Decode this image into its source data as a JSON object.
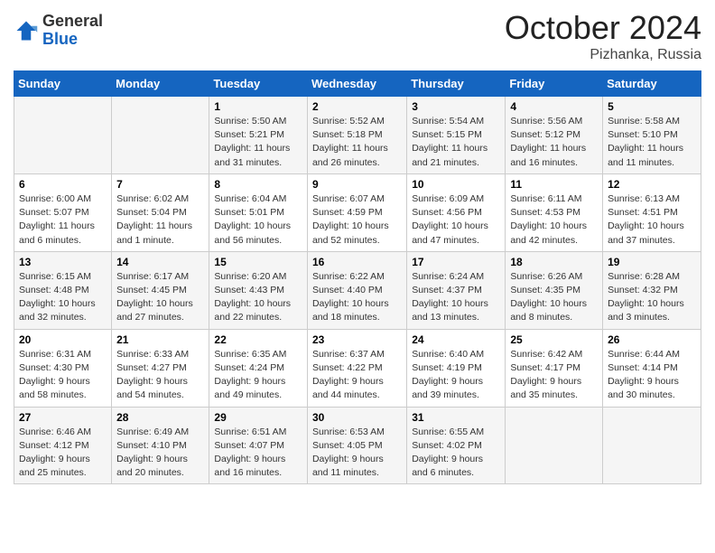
{
  "header": {
    "logo_general": "General",
    "logo_blue": "Blue",
    "month": "October 2024",
    "location": "Pizhanka, Russia"
  },
  "days_of_week": [
    "Sunday",
    "Monday",
    "Tuesday",
    "Wednesday",
    "Thursday",
    "Friday",
    "Saturday"
  ],
  "weeks": [
    [
      {
        "num": "",
        "info": ""
      },
      {
        "num": "",
        "info": ""
      },
      {
        "num": "1",
        "info": "Sunrise: 5:50 AM\nSunset: 5:21 PM\nDaylight: 11 hours\nand 31 minutes."
      },
      {
        "num": "2",
        "info": "Sunrise: 5:52 AM\nSunset: 5:18 PM\nDaylight: 11 hours\nand 26 minutes."
      },
      {
        "num": "3",
        "info": "Sunrise: 5:54 AM\nSunset: 5:15 PM\nDaylight: 11 hours\nand 21 minutes."
      },
      {
        "num": "4",
        "info": "Sunrise: 5:56 AM\nSunset: 5:12 PM\nDaylight: 11 hours\nand 16 minutes."
      },
      {
        "num": "5",
        "info": "Sunrise: 5:58 AM\nSunset: 5:10 PM\nDaylight: 11 hours\nand 11 minutes."
      }
    ],
    [
      {
        "num": "6",
        "info": "Sunrise: 6:00 AM\nSunset: 5:07 PM\nDaylight: 11 hours\nand 6 minutes."
      },
      {
        "num": "7",
        "info": "Sunrise: 6:02 AM\nSunset: 5:04 PM\nDaylight: 11 hours\nand 1 minute."
      },
      {
        "num": "8",
        "info": "Sunrise: 6:04 AM\nSunset: 5:01 PM\nDaylight: 10 hours\nand 56 minutes."
      },
      {
        "num": "9",
        "info": "Sunrise: 6:07 AM\nSunset: 4:59 PM\nDaylight: 10 hours\nand 52 minutes."
      },
      {
        "num": "10",
        "info": "Sunrise: 6:09 AM\nSunset: 4:56 PM\nDaylight: 10 hours\nand 47 minutes."
      },
      {
        "num": "11",
        "info": "Sunrise: 6:11 AM\nSunset: 4:53 PM\nDaylight: 10 hours\nand 42 minutes."
      },
      {
        "num": "12",
        "info": "Sunrise: 6:13 AM\nSunset: 4:51 PM\nDaylight: 10 hours\nand 37 minutes."
      }
    ],
    [
      {
        "num": "13",
        "info": "Sunrise: 6:15 AM\nSunset: 4:48 PM\nDaylight: 10 hours\nand 32 minutes."
      },
      {
        "num": "14",
        "info": "Sunrise: 6:17 AM\nSunset: 4:45 PM\nDaylight: 10 hours\nand 27 minutes."
      },
      {
        "num": "15",
        "info": "Sunrise: 6:20 AM\nSunset: 4:43 PM\nDaylight: 10 hours\nand 22 minutes."
      },
      {
        "num": "16",
        "info": "Sunrise: 6:22 AM\nSunset: 4:40 PM\nDaylight: 10 hours\nand 18 minutes."
      },
      {
        "num": "17",
        "info": "Sunrise: 6:24 AM\nSunset: 4:37 PM\nDaylight: 10 hours\nand 13 minutes."
      },
      {
        "num": "18",
        "info": "Sunrise: 6:26 AM\nSunset: 4:35 PM\nDaylight: 10 hours\nand 8 minutes."
      },
      {
        "num": "19",
        "info": "Sunrise: 6:28 AM\nSunset: 4:32 PM\nDaylight: 10 hours\nand 3 minutes."
      }
    ],
    [
      {
        "num": "20",
        "info": "Sunrise: 6:31 AM\nSunset: 4:30 PM\nDaylight: 9 hours\nand 58 minutes."
      },
      {
        "num": "21",
        "info": "Sunrise: 6:33 AM\nSunset: 4:27 PM\nDaylight: 9 hours\nand 54 minutes."
      },
      {
        "num": "22",
        "info": "Sunrise: 6:35 AM\nSunset: 4:24 PM\nDaylight: 9 hours\nand 49 minutes."
      },
      {
        "num": "23",
        "info": "Sunrise: 6:37 AM\nSunset: 4:22 PM\nDaylight: 9 hours\nand 44 minutes."
      },
      {
        "num": "24",
        "info": "Sunrise: 6:40 AM\nSunset: 4:19 PM\nDaylight: 9 hours\nand 39 minutes."
      },
      {
        "num": "25",
        "info": "Sunrise: 6:42 AM\nSunset: 4:17 PM\nDaylight: 9 hours\nand 35 minutes."
      },
      {
        "num": "26",
        "info": "Sunrise: 6:44 AM\nSunset: 4:14 PM\nDaylight: 9 hours\nand 30 minutes."
      }
    ],
    [
      {
        "num": "27",
        "info": "Sunrise: 6:46 AM\nSunset: 4:12 PM\nDaylight: 9 hours\nand 25 minutes."
      },
      {
        "num": "28",
        "info": "Sunrise: 6:49 AM\nSunset: 4:10 PM\nDaylight: 9 hours\nand 20 minutes."
      },
      {
        "num": "29",
        "info": "Sunrise: 6:51 AM\nSunset: 4:07 PM\nDaylight: 9 hours\nand 16 minutes."
      },
      {
        "num": "30",
        "info": "Sunrise: 6:53 AM\nSunset: 4:05 PM\nDaylight: 9 hours\nand 11 minutes."
      },
      {
        "num": "31",
        "info": "Sunrise: 6:55 AM\nSunset: 4:02 PM\nDaylight: 9 hours\nand 6 minutes."
      },
      {
        "num": "",
        "info": ""
      },
      {
        "num": "",
        "info": ""
      }
    ]
  ]
}
